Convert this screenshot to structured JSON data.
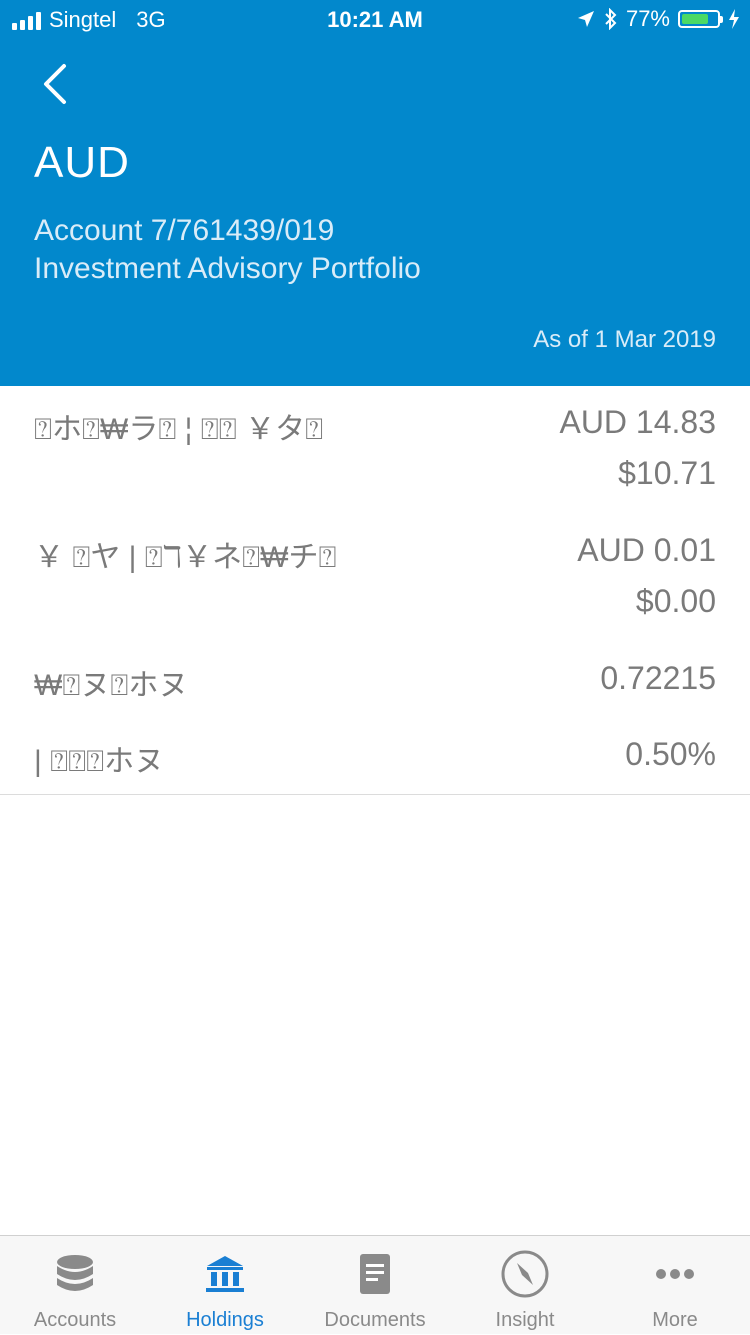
{
  "status_bar": {
    "carrier": "Singtel",
    "network": "3G",
    "time": "10:21 AM",
    "battery_percent": "77%",
    "battery_level": 0.77,
    "battery_color": "#4cd964"
  },
  "header": {
    "back_icon": "chevron-left-icon",
    "title": "AUD",
    "account_line": "Account 7/761439/019",
    "portfolio_line": "Investment Advisory Portfolio",
    "as_of": "As of 1 Mar 2019",
    "bg_color": "#0288cc"
  },
  "rows": [
    {
      "label": "⍰ホ⍰₩ラ⍰ ¦ ⍰⍰ ￥タ⍰",
      "value": "AUD 14.83",
      "value2": "$10.71"
    },
    {
      "label": "￥ ⍰ヤ | ⍰ℸ￥ネ⍰₩チ⍰",
      "value": "AUD 0.01",
      "value2": "$0.00"
    },
    {
      "label": "₩⍰ヌ⍰ホヌ",
      "value": "0.72215"
    },
    {
      "label": "| ⍰⍰⍰ホヌ",
      "value": "0.50%"
    }
  ],
  "tabs": [
    {
      "label": "Accounts",
      "icon": "database-icon",
      "active": false
    },
    {
      "label": "Holdings",
      "icon": "bank-icon",
      "active": true
    },
    {
      "label": "Documents",
      "icon": "document-icon",
      "active": false
    },
    {
      "label": "Insight",
      "icon": "compass-icon",
      "active": false
    },
    {
      "label": "More",
      "icon": "more-dots-icon",
      "active": false
    }
  ],
  "colors": {
    "accent": "#1a7fd3",
    "text_gray": "#7a7a7a"
  }
}
